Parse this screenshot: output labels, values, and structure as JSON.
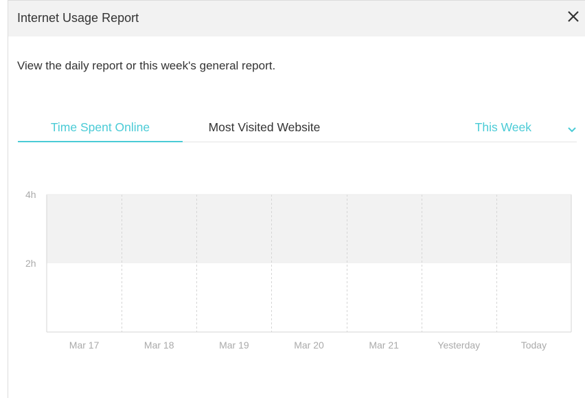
{
  "dialog": {
    "title": "Internet Usage Report",
    "description": "View the daily report or this week's general report."
  },
  "tabs": [
    {
      "label": "Time Spent Online",
      "active": true
    },
    {
      "label": "Most Visited Website",
      "active": false
    }
  ],
  "period": {
    "selected": "This Week"
  },
  "icons": {
    "close": "close-icon",
    "dropdown": "chevron-down-icon"
  },
  "colors": {
    "accent": "#4acbd6",
    "band": "#f2f2f2",
    "grid": "#d5d5d5"
  },
  "chart_data": {
    "type": "bar",
    "categories": [
      "Mar 17",
      "Mar 18",
      "Mar 19",
      "Mar 20",
      "Mar 21",
      "Yesterday",
      "Today"
    ],
    "series": [
      {
        "values": [
          0,
          0,
          0,
          0,
          0,
          0,
          0
        ]
      }
    ],
    "ylim": [
      0,
      4
    ],
    "yticks": [
      {
        "value": 2,
        "label": "2h"
      },
      {
        "value": 4,
        "label": "4h"
      }
    ],
    "grid": true,
    "band": [
      2,
      4
    ]
  }
}
